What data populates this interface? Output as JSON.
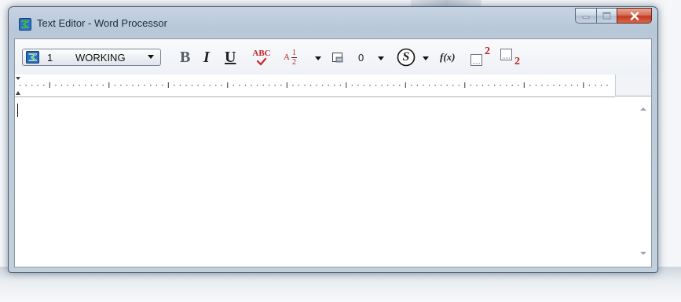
{
  "window": {
    "title": "Text Editor - Word Processor",
    "minimize_label": "",
    "maximize_label": "",
    "close_label": ""
  },
  "toolbar": {
    "level_number": "1",
    "level_name": "WORKING",
    "bold_label": "B",
    "italic_label": "I",
    "underline_label": "U",
    "spell_label": "ABC",
    "fraction_prefix": "A",
    "fraction_num": "1",
    "fraction_den": "2",
    "numbering_value": "0",
    "symbol_label": "S",
    "formula_label": "f(x)",
    "superscript_label": "2",
    "subscript_label": "2"
  },
  "editor": {
    "content": ""
  },
  "colors": {
    "titlebar": "#c6d3e2",
    "close_button": "#c2391f",
    "spell_red": "#c0262c",
    "script_red": "#b42020"
  },
  "icons": {
    "app": "app-logo-icon",
    "level": "level-icon",
    "spell_check": "spell-check-icon",
    "fraction": "fraction-icon",
    "text_box": "text-box-icon",
    "symbol": "symbol-icon",
    "superscript": "superscript-icon",
    "subscript": "subscript-icon"
  }
}
